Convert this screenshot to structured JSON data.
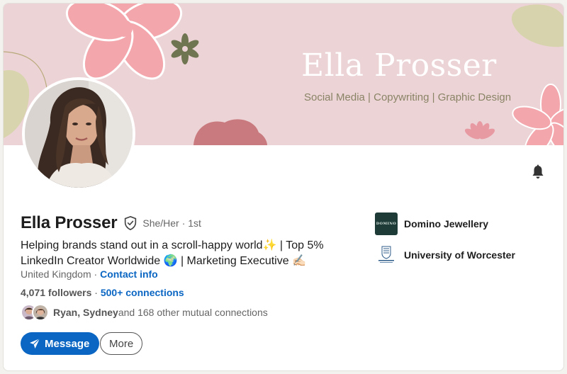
{
  "banner": {
    "name": "Ella Prosser",
    "tagline": "Social Media | Copywriting | Graphic Design"
  },
  "profile": {
    "name": "Ella Prosser",
    "pronouns": "She/Her",
    "degree": "· 1st",
    "headline": "Helping brands stand out in a scroll-happy world✨ | Top 5% LinkedIn Creator Worldwide 🌍 | Marketing Executive ✍🏻",
    "location": "United Kingdom",
    "location_separator": " · ",
    "contact_label": "Contact info",
    "followers": "4,071 followers",
    "stats_separator": " · ",
    "connections_label": "500+ connections",
    "mutual_names": "Ryan, Sydney",
    "mutual_rest": " and 168 other mutual connections"
  },
  "actions": {
    "message_label": "Message",
    "more_label": "More"
  },
  "organizations": [
    {
      "name": "Domino Jewellery",
      "logo_text": "DOMINO",
      "icon": "domino-jewellery-logo"
    },
    {
      "name": "University of Worcester",
      "logo_text": "UNIVERSITY OF WORCESTER",
      "icon": "university-crest-logo"
    }
  ],
  "icons": {
    "notify": "bell-icon",
    "verified": "verified-shield-icon",
    "message": "send-icon"
  },
  "colors": {
    "accent": "#0a66c2",
    "banner_bg": "#ecd3d6",
    "flower_pink": "#f3a7ad",
    "olive": "#6f7550"
  }
}
